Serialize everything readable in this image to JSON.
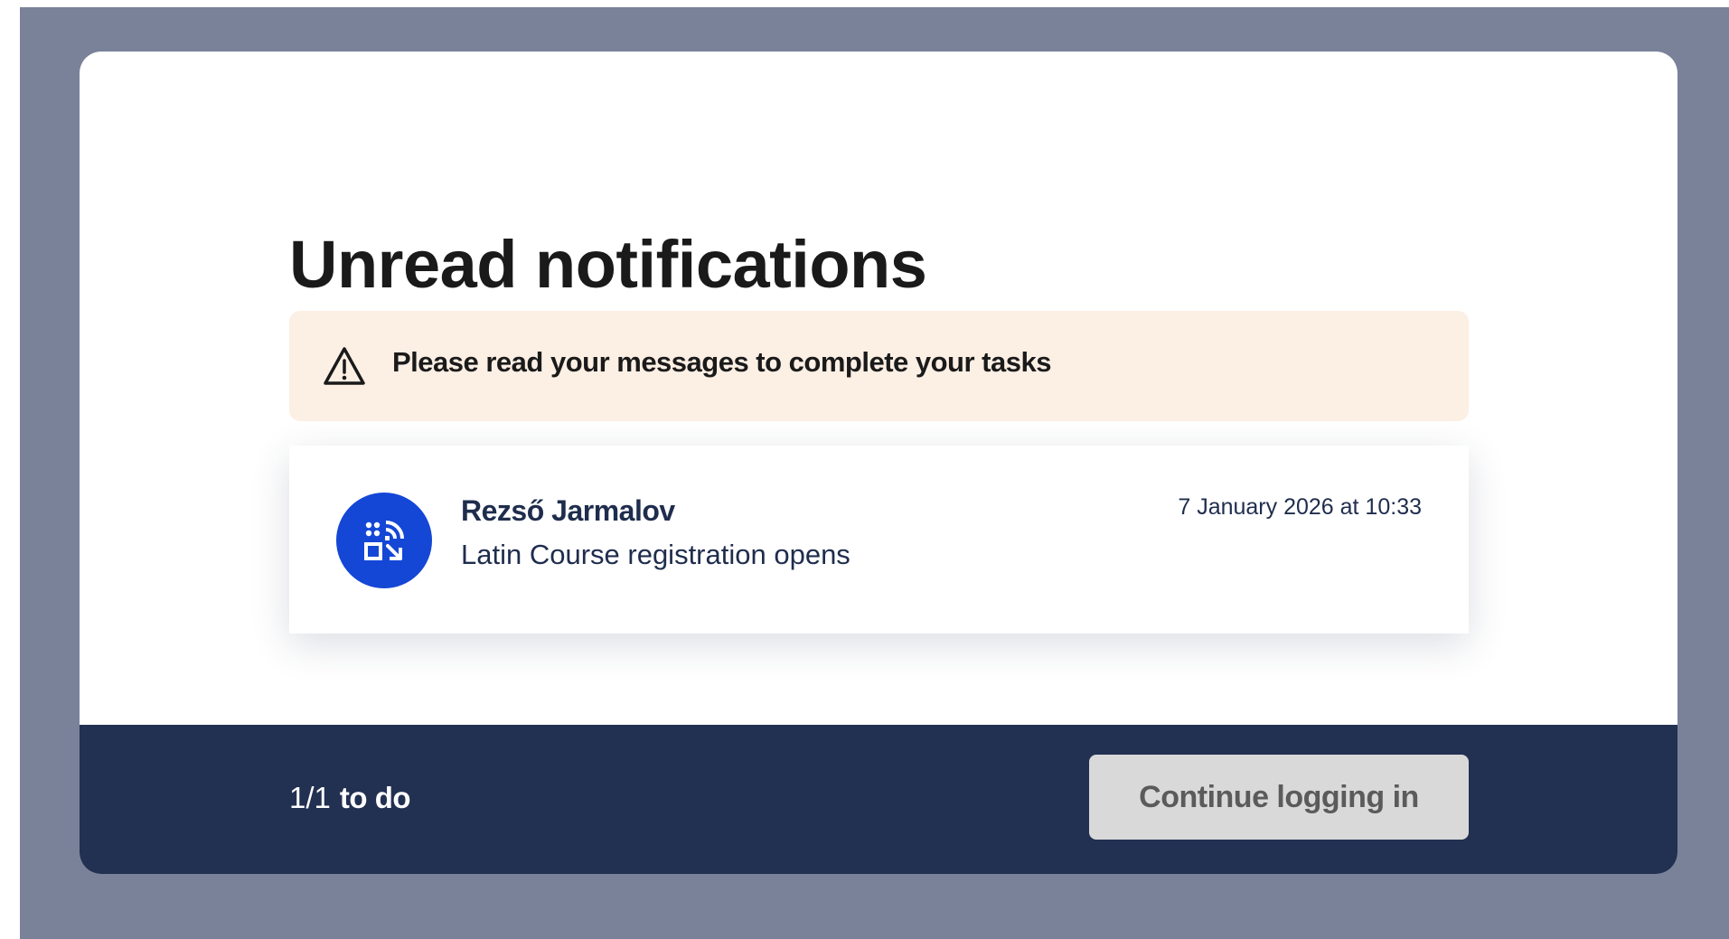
{
  "modal": {
    "title": "Unread notifications",
    "alert": {
      "icon": "warning-triangle-icon",
      "text": "Please read your messages to complete your tasks",
      "background": "#fcefe4"
    },
    "notifications": [
      {
        "avatar_icon": "qr-code-icon",
        "avatar_color": "#1447d6",
        "sender": "Rezső Jarmalov",
        "subject": "Latin Course registration opens",
        "date": "7 January 2026 at 10:33"
      }
    ]
  },
  "footer": {
    "progress_count": "1/1",
    "progress_label": "to do",
    "continue_label": "Continue logging in",
    "continue_enabled": false,
    "background": "#223051"
  },
  "colors": {
    "overlay": "#7a8299",
    "accent": "#1447d6"
  }
}
